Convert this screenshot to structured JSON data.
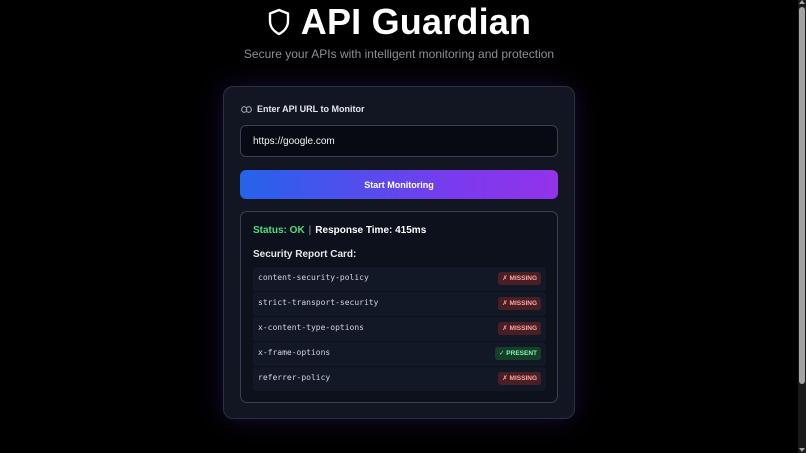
{
  "header": {
    "title": "API Guardian",
    "subtitle": "Secure your APIs with intelligent monitoring and protection",
    "icon": "shield-icon"
  },
  "form": {
    "label": "Enter API URL to Monitor",
    "label_icon": "link-icon",
    "url_value": "https://google.com",
    "button_label": "Start Monitoring"
  },
  "result": {
    "status_label": "Status: OK",
    "separator": "|",
    "response_time_label": "Response Time: 415ms",
    "report_title": "Security Report Card:",
    "headers": [
      {
        "name": "content-security-policy",
        "status": "✗ MISSING"
      },
      {
        "name": "strict-transport-security",
        "status": "✗ MISSING"
      },
      {
        "name": "x-content-type-options",
        "status": "✗ MISSING"
      },
      {
        "name": "x-frame-options",
        "status": "✓ PRESENT"
      },
      {
        "name": "referrer-policy",
        "status": "✗ MISSING"
      }
    ]
  },
  "colors": {
    "background": "#000000",
    "card": "#111622",
    "ok": "#4ade80",
    "missing": "#fca5a5",
    "present": "#86efac",
    "gradient_start": "#2563eb",
    "gradient_end": "#9333ea"
  }
}
